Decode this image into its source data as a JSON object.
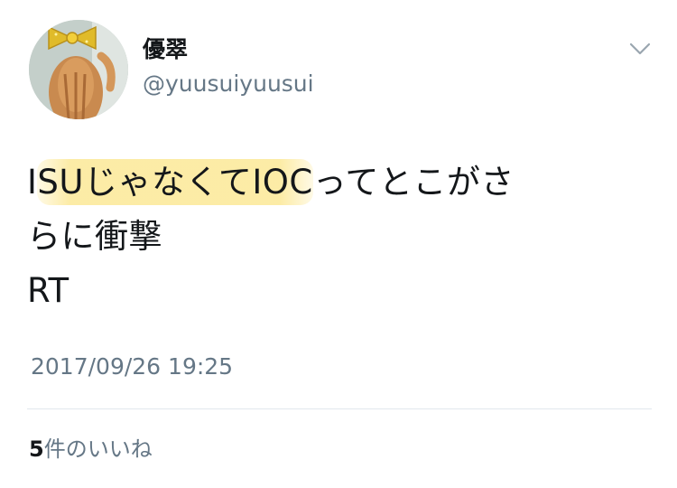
{
  "user": {
    "display_name": "優翠",
    "handle": "@yuusuiyuusui",
    "avatar_icon": "cat-with-gold-bow-avatar"
  },
  "menu": {
    "icon": "chevron-down-icon"
  },
  "tweet": {
    "segments": {
      "pre": "I",
      "highlight": "SUじゃなくてIOC",
      "post": "ってとこがさ"
    },
    "line2": "らに衝撃",
    "line3": "RT",
    "highlight_color": "#fce896"
  },
  "timestamp": "2017/09/26 19:25",
  "likes": {
    "count": "5",
    "label": "件のいいね"
  },
  "colors": {
    "text": "#14171a",
    "secondary": "#657786",
    "divider": "#e1e8ed"
  }
}
